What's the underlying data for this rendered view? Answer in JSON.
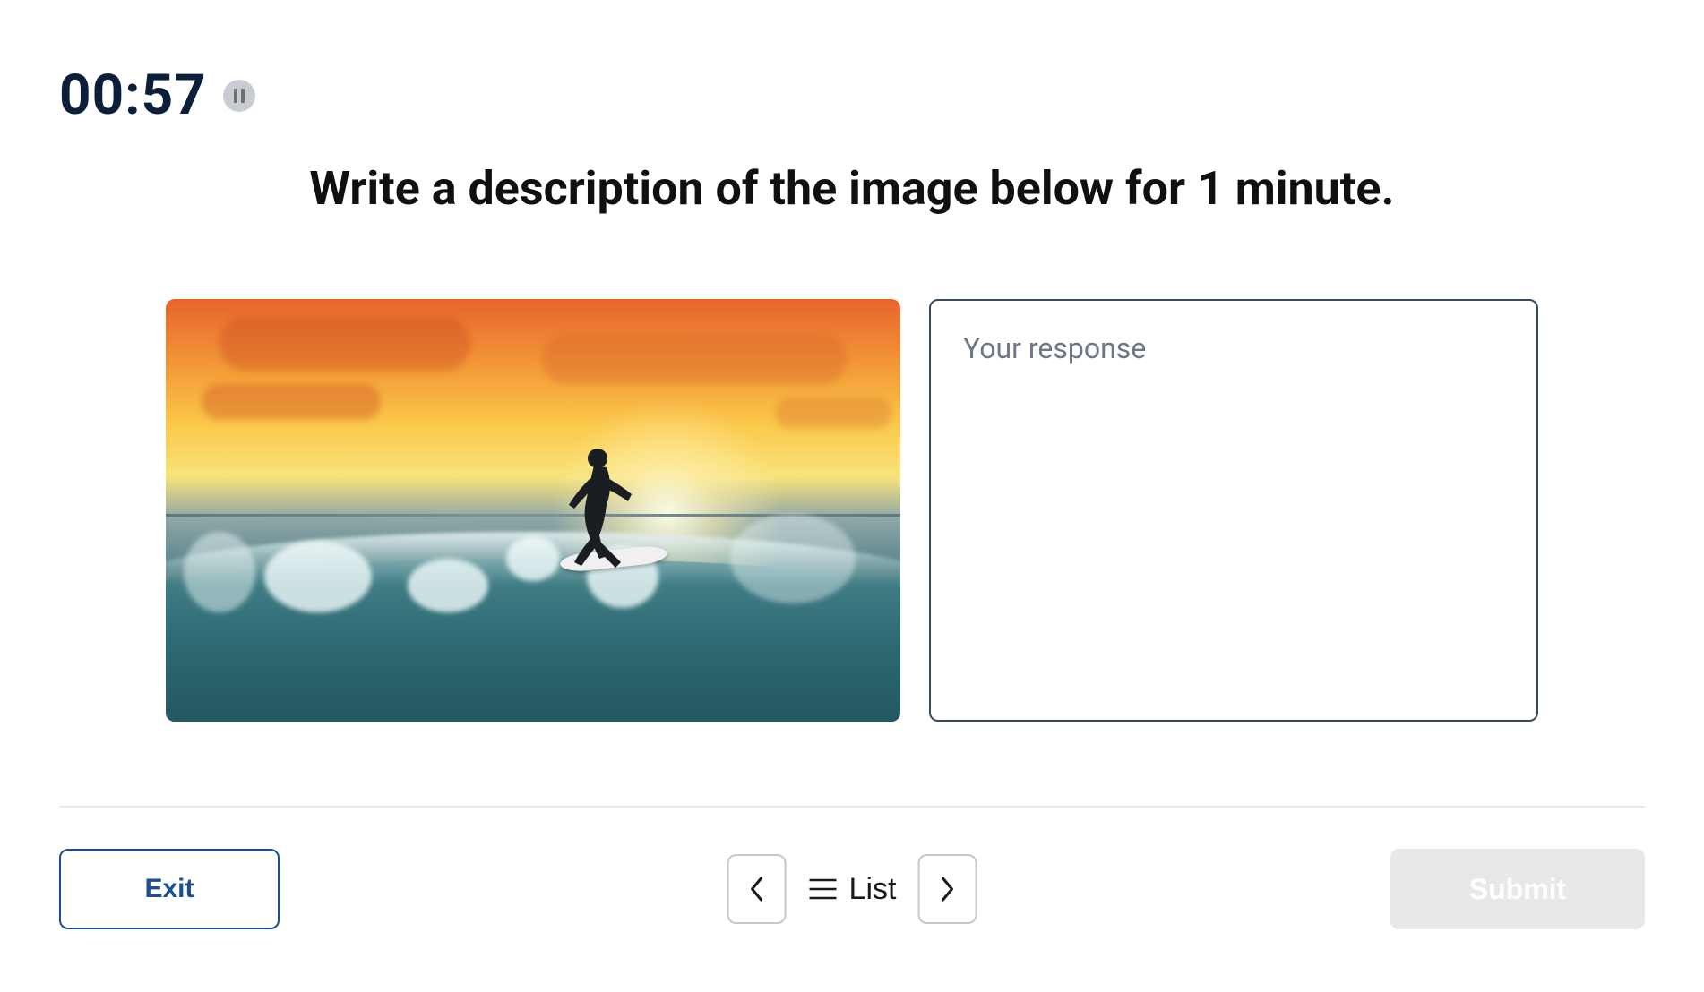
{
  "timer": {
    "display": "00:57"
  },
  "instruction": "Write a description of the image below for 1 minute.",
  "image": {
    "alt": "Surfer riding a wave at sunset"
  },
  "response": {
    "placeholder": "Your response",
    "value": ""
  },
  "footer": {
    "exit_label": "Exit",
    "list_label": "List",
    "submit_label": "Submit",
    "submit_enabled": false
  }
}
